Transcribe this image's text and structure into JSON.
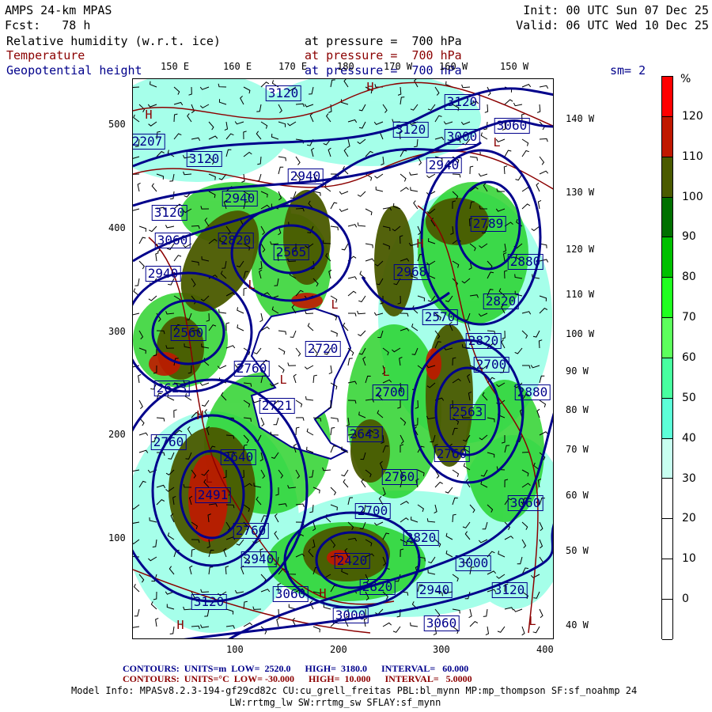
{
  "header": {
    "model": "AMPS 24-km MPAS",
    "init": "Init: 00 UTC Sun 07 Dec 25",
    "fcst": "Fcst:   78 h",
    "valid": "Valid: 06 UTC Wed 10 Dec 25",
    "field1": "Relative humidity (w.r.t. ice)",
    "field1_level": "at pressure =  700 hPa",
    "field2": "Temperature",
    "field2_level": "at pressure =  700 hPa",
    "field3": "Geopotential height",
    "field3_level": "at pressure =  700 hPa",
    "smoothing": "sm= 2"
  },
  "axes": {
    "top_lon": [
      "150 E",
      "160 E",
      "170 E",
      "180",
      "170 W",
      "160 W",
      "150 W"
    ],
    "right_lon": [
      "140 W",
      "130 W",
      "120 W",
      "110 W",
      "100 W",
      "90 W",
      "80 W",
      "70 W",
      "60 W",
      "50 W",
      "40 W"
    ],
    "left_y": [
      "500",
      "400",
      "300",
      "200",
      "100"
    ],
    "bottom_x": [
      "100",
      "200",
      "300",
      "400"
    ]
  },
  "colorbar": {
    "unit": "%",
    "labels": [
      "120",
      "110",
      "100",
      "90",
      "80",
      "70",
      "60",
      "50",
      "40",
      "30",
      "20",
      "10",
      "0"
    ],
    "colors": [
      "#ff0000",
      "#c01800",
      "#4a5a00",
      "#007000",
      "#00c000",
      "#20ff20",
      "#5cff5c",
      "#48ffa0",
      "#5cffd8",
      "#c8fff0",
      "#ffffff",
      "#ffffff",
      "#ffffff",
      "#ffffff"
    ]
  },
  "map": {
    "contour_labels": [
      "3120",
      "2207",
      "3120",
      "2940",
      "2940",
      "3120",
      "3060",
      "2820",
      "2565",
      "2940",
      "2560",
      "2760",
      "2720",
      "2623",
      "2721",
      "2760",
      "2640",
      "2491",
      "2760",
      "2940",
      "3060",
      "3120",
      "3120",
      "3120",
      "3060",
      "3000",
      "2940",
      "2789",
      "2968",
      "2880",
      "2820",
      "2570",
      "2820",
      "2700",
      "2700",
      "2880",
      "2563",
      "2643",
      "2760",
      "2760",
      "3060",
      "2700",
      "2820",
      "2420",
      "3000",
      "2820",
      "2940",
      "3120",
      "3000",
      "3060"
    ],
    "markers": [
      "H",
      "L",
      "H",
      "L",
      "L",
      "H",
      "L",
      "H",
      "L",
      "L",
      "H",
      "H",
      "L"
    ],
    "colors": {
      "rh_high": "#4a5a00",
      "rh_mid": "#00c000",
      "temperature": "#8b0000",
      "height": "#00008b"
    }
  },
  "footer": {
    "height_contours": "CONTOURS:  UNITS=m  LOW=  2520.0      HIGH=  3180.0      INTERVAL=   60.000",
    "temp_contours": "CONTOURS:  UNITS=°C  LOW= -30.000      HIGH=  10.000      INTERVAL=   5.0000",
    "model_info": "Model Info: MPASv8.2.3-194-gf29cd82c CU:cu_grell_freitas PBL:bl_mynn MP:mp_thompson SF:sf_noahmp 24",
    "model_info2": "LW:rrtmg_lw SW:rrtmg_sw SFLAY:sf_mynn"
  }
}
